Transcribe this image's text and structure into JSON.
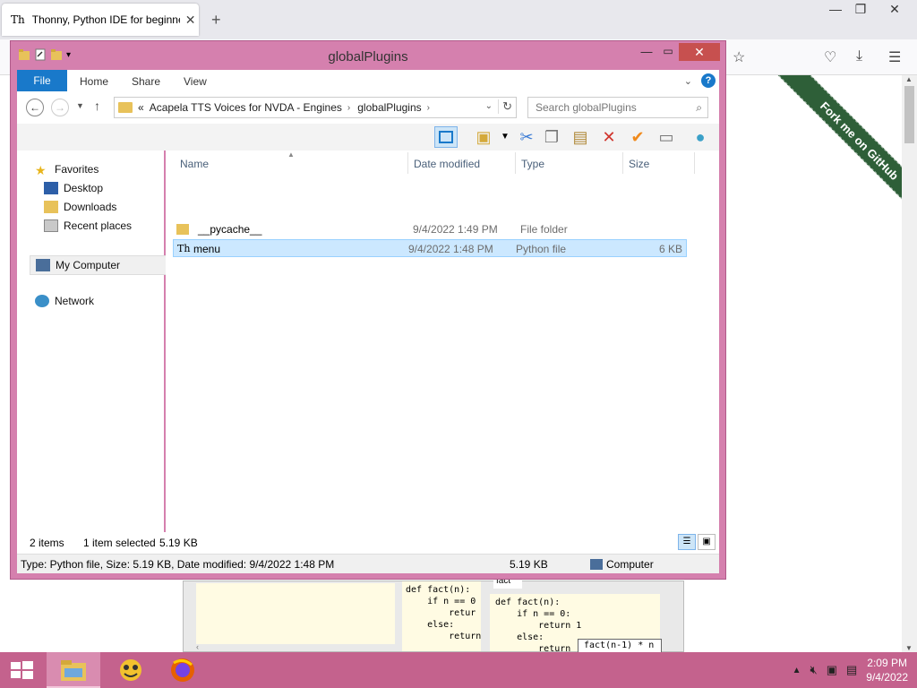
{
  "browser": {
    "tab_title": "Thonny, Python IDE for beginne",
    "tab_favicon": "Th",
    "tab_close": "✕",
    "new_tab": "+",
    "fork_ribbon": "Fork me on GitHub",
    "window_controls": {
      "minimize": "—",
      "maximize": "❐",
      "close": "✕"
    },
    "toolbar_icons": [
      "star-icon",
      "pocket-icon",
      "download-icon",
      "menu-icon"
    ]
  },
  "explorer": {
    "title": "globalPlugins",
    "ribbon_tabs": {
      "file": "File",
      "home": "Home",
      "share": "Share",
      "view": "View"
    },
    "help": "?",
    "address": {
      "overflow": "«",
      "crumbs": [
        "Acapela TTS Voices for NVDA - Engines",
        "globalPlugins"
      ]
    },
    "search": {
      "placeholder": "Search globalPlugins"
    },
    "nav": {
      "favorites": "Favorites",
      "desktop": "Desktop",
      "downloads": "Downloads",
      "recent": "Recent places",
      "computer": "My Computer",
      "network": "Network"
    },
    "columns": {
      "name": "Name",
      "date": "Date modified",
      "type": "Type",
      "size": "Size"
    },
    "files": [
      {
        "name": "__pycache__",
        "date": "9/4/2022 1:49 PM",
        "type": "File folder",
        "size": "",
        "icon": "folder-icon"
      },
      {
        "name": "menu",
        "date": "9/4/2022 1:48 PM",
        "type": "Python file",
        "size": "6 KB",
        "icon": "thonny-file-icon"
      }
    ],
    "status": {
      "items": "2 items",
      "selected": "1 item selected",
      "selected_size": "5.19 KB"
    },
    "details": {
      "info": "Type: Python file, Size: 5.19 KB, Date modified: 9/4/2022 1:48 PM",
      "size": "5.19 KB",
      "location": "Computer"
    }
  },
  "thonny": {
    "code_left": "def fact(n):\n    if n == 0\n        retur\n    else:\n        return",
    "tab_label": "fact",
    "code_right": "def fact(n):\n    if n == 0:\n        return 1\n    else:\n        return",
    "popup": "fact(n-1) * n"
  },
  "taskbar": {
    "time": "2:09 PM",
    "date": "9/4/2022"
  },
  "colors": {
    "window_frame": "#d580ae",
    "taskbar": "#c4628d",
    "accent": "#1979ca",
    "ribbon_green": "#2e5f38"
  }
}
